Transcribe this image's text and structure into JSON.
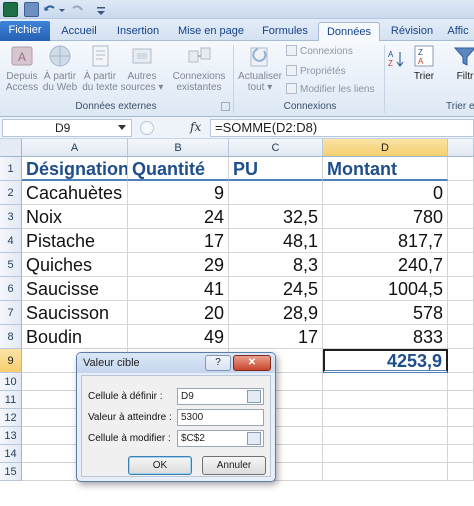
{
  "ribbon": {
    "tabs": [
      "Fichier",
      "Accueil",
      "Insertion",
      "Mise en page",
      "Formules",
      "Données",
      "Révision",
      "Affic"
    ],
    "active_tab": "Données",
    "groups": {
      "external": {
        "label": "Données externes",
        "buttons": [
          {
            "line1": "Depuis",
            "line2": "Access"
          },
          {
            "line1": "À partir",
            "line2": "du Web"
          },
          {
            "line1": "À partir",
            "line2": "du texte"
          },
          {
            "line1": "Autres",
            "line2": "sources ▾"
          },
          {
            "line1": "Connexions",
            "line2": "existantes"
          }
        ]
      },
      "connections": {
        "label": "Connexions",
        "refresh": {
          "line1": "Actualiser",
          "line2": "tout ▾"
        },
        "items": [
          "Connexions",
          "Propriétés",
          "Modifier les liens"
        ]
      },
      "sort": {
        "label": "Trier et",
        "sort_label": "Trier",
        "filter_label": "Filtr"
      }
    }
  },
  "formula_bar": {
    "name_box": "D9",
    "fx": "fx",
    "formula": "=SOMME(D2:D8)"
  },
  "grid": {
    "columns": [
      "A",
      "B",
      "C",
      "D"
    ],
    "rows": [
      "1",
      "2",
      "3",
      "4",
      "5",
      "6",
      "7",
      "8",
      "9",
      "10",
      "11",
      "12",
      "13",
      "14",
      "15"
    ],
    "headers": [
      "Désignation",
      "Quantité",
      "PU",
      "Montant"
    ],
    "data": [
      [
        "Cacahuètes",
        "9",
        "",
        "0"
      ],
      [
        "Noix",
        "24",
        "32,5",
        "780"
      ],
      [
        "Pistache",
        "17",
        "48,1",
        "817,7"
      ],
      [
        "Quiches",
        "29",
        "8,3",
        "240,7"
      ],
      [
        "Saucisse",
        "41",
        "24,5",
        "1004,5"
      ],
      [
        "Saucisson",
        "20",
        "28,9",
        "578"
      ],
      [
        "Boudin",
        "49",
        "17",
        "833"
      ]
    ],
    "total": "4253,9"
  },
  "dialog": {
    "title": "Valeur cible",
    "help": "?",
    "close": "✕",
    "fields": [
      {
        "label": "Cellule à définir :",
        "value": "D9"
      },
      {
        "label": "Valeur à atteindre :",
        "value": "5300"
      },
      {
        "label": "Cellule à modifier :",
        "value": "$C$2"
      }
    ],
    "ok": "OK",
    "cancel": "Annuler"
  },
  "colors": {
    "header_text": "#1f4e8c",
    "accent": "#4f81bd",
    "selected_header": "#f6cf6e"
  }
}
